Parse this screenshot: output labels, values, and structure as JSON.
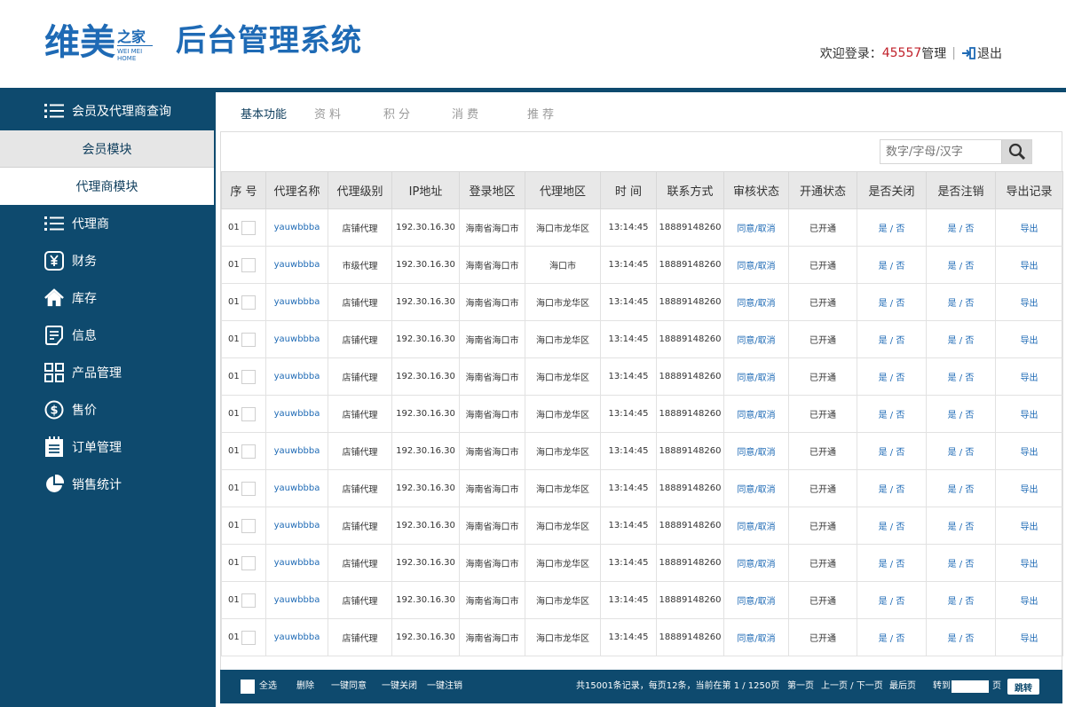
{
  "header": {
    "logo_main": "维美",
    "logo_zhi": "之家",
    "logo_en_line1": "WEI MEI",
    "logo_en_line2": "HOME",
    "system_title": "后台管理系统",
    "welcome_label": "欢迎登录：",
    "user_id": "45557",
    "user_role": "管理",
    "separator": "|",
    "logout_label": "退出"
  },
  "sidebar": {
    "items": [
      {
        "label": "会员及代理商查询",
        "icon": "list-icon"
      },
      {
        "label": "代理商",
        "icon": "list-icon"
      },
      {
        "label": "财务",
        "icon": "yen-icon"
      },
      {
        "label": "库存",
        "icon": "home-icon"
      },
      {
        "label": "信息",
        "icon": "document-icon"
      },
      {
        "label": "产品管理",
        "icon": "grid-icon"
      },
      {
        "label": "售价",
        "icon": "dollar-icon"
      },
      {
        "label": "订单管理",
        "icon": "clipboard-icon"
      },
      {
        "label": "销售统计",
        "icon": "pie-chart-icon"
      }
    ],
    "sub_items": [
      {
        "label": "会员模块"
      },
      {
        "label": "代理商模块"
      }
    ]
  },
  "tabs": [
    {
      "label": "基本功能"
    },
    {
      "label": "资料"
    },
    {
      "label": "积分"
    },
    {
      "label": "消费"
    },
    {
      "label": "推荐"
    }
  ],
  "search": {
    "placeholder": "数字/字母/汉字"
  },
  "table": {
    "headers": [
      "序 号",
      "代理名称",
      "代理级别",
      "IP地址",
      "登录地区",
      "代理地区",
      "时 间",
      "联系方式",
      "审核状态",
      "开通状态",
      "是否关闭",
      "是否注销",
      "导出记录"
    ],
    "rows": [
      [
        "01",
        "yauwbbba",
        "店铺代理",
        "192.30.16.30",
        "海南省海口市",
        "海口市龙华区",
        "13:14:45",
        "18889148260",
        "同意/取消",
        "已开通",
        "是 / 否",
        "是 / 否",
        "导出"
      ],
      [
        "01",
        "yauwbbba",
        "市级代理",
        "192.30.16.30",
        "海南省海口市",
        "海口市",
        "13:14:45",
        "18889148260",
        "同意/取消",
        "已开通",
        "是 / 否",
        "是 / 否",
        "导出"
      ],
      [
        "01",
        "yauwbbba",
        "店铺代理",
        "192.30.16.30",
        "海南省海口市",
        "海口市龙华区",
        "13:14:45",
        "18889148260",
        "同意/取消",
        "已开通",
        "是 / 否",
        "是 / 否",
        "导出"
      ],
      [
        "01",
        "yauwbbba",
        "店铺代理",
        "192.30.16.30",
        "海南省海口市",
        "海口市龙华区",
        "13:14:45",
        "18889148260",
        "同意/取消",
        "已开通",
        "是 / 否",
        "是 / 否",
        "导出"
      ],
      [
        "01",
        "yauwbbba",
        "店铺代理",
        "192.30.16.30",
        "海南省海口市",
        "海口市龙华区",
        "13:14:45",
        "18889148260",
        "同意/取消",
        "已开通",
        "是 / 否",
        "是 / 否",
        "导出"
      ],
      [
        "01",
        "yauwbbba",
        "店铺代理",
        "192.30.16.30",
        "海南省海口市",
        "海口市龙华区",
        "13:14:45",
        "18889148260",
        "同意/取消",
        "已开通",
        "是 / 否",
        "是 / 否",
        "导出"
      ],
      [
        "01",
        "yauwbbba",
        "店铺代理",
        "192.30.16.30",
        "海南省海口市",
        "海口市龙华区",
        "13:14:45",
        "18889148260",
        "同意/取消",
        "已开通",
        "是 / 否",
        "是 / 否",
        "导出"
      ],
      [
        "01",
        "yauwbbba",
        "店铺代理",
        "192.30.16.30",
        "海南省海口市",
        "海口市龙华区",
        "13:14:45",
        "18889148260",
        "同意/取消",
        "已开通",
        "是 / 否",
        "是 / 否",
        "导出"
      ],
      [
        "01",
        "yauwbbba",
        "店铺代理",
        "192.30.16.30",
        "海南省海口市",
        "海口市龙华区",
        "13:14:45",
        "18889148260",
        "同意/取消",
        "已开通",
        "是 / 否",
        "是 / 否",
        "导出"
      ],
      [
        "01",
        "yauwbbba",
        "店铺代理",
        "192.30.16.30",
        "海南省海口市",
        "海口市龙华区",
        "13:14:45",
        "18889148260",
        "同意/取消",
        "已开通",
        "是 / 否",
        "是 / 否",
        "导出"
      ],
      [
        "01",
        "yauwbbba",
        "店铺代理",
        "192.30.16.30",
        "海南省海口市",
        "海口市龙华区",
        "13:14:45",
        "18889148260",
        "同意/取消",
        "已开通",
        "是 / 否",
        "是 / 否",
        "导出"
      ],
      [
        "01",
        "yauwbbba",
        "店铺代理",
        "192.30.16.30",
        "海南省海口市",
        "海口市龙华区",
        "13:14:45",
        "18889148260",
        "同意/取消",
        "已开通",
        "是 / 否",
        "是 / 否",
        "导出"
      ]
    ]
  },
  "footer": {
    "select_all": "全选",
    "delete": "删除",
    "approve_all": "一键同意",
    "close_all": "一键关闭",
    "cancel_all": "一键注销",
    "summary": "共15001条记录，每页12条，当前在第 1 / 1250页",
    "first_page": "第一页",
    "prev_next": "上一页 / 下一页",
    "last_page": "最后页",
    "goto_label": "转到",
    "page_unit": "页",
    "goto_button": "跳转"
  },
  "colors": {
    "brand_blue": "#1e6ab5",
    "sidebar_navy": "#0e4a6e",
    "user_id_red": "#c0202a"
  }
}
